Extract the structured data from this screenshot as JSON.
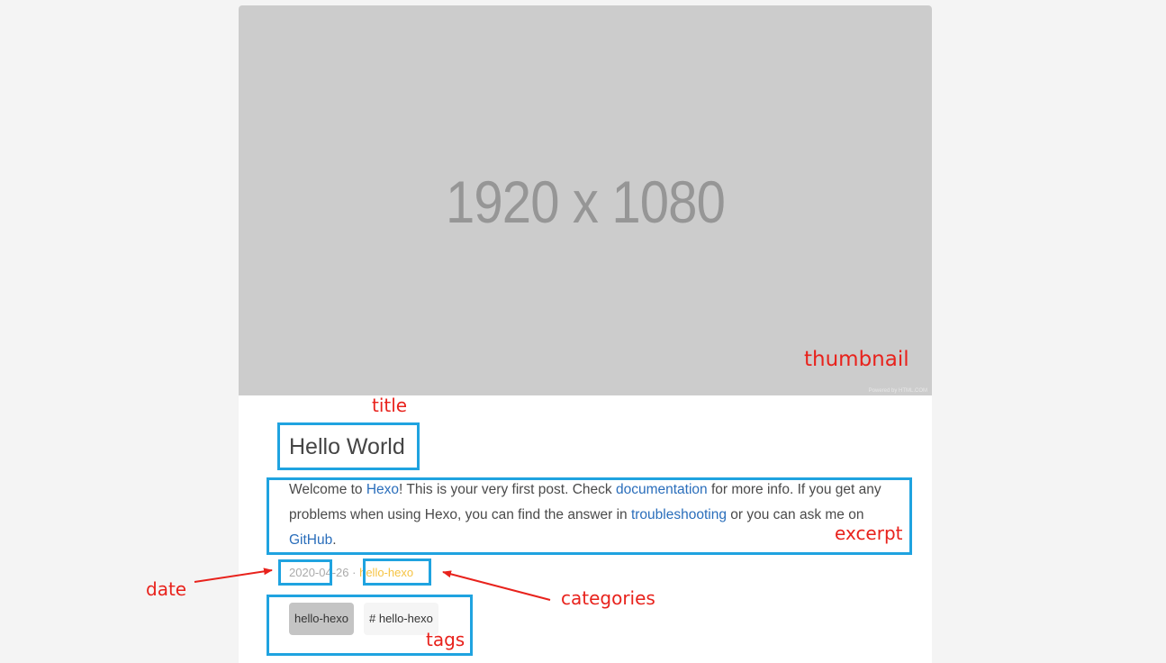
{
  "thumbnail": {
    "placeholder_text": "1920 x 1080",
    "powered_text": "Powered by HTML.COM"
  },
  "post": {
    "title": "Hello World",
    "excerpt": {
      "part1": "Welcome to ",
      "link1": "Hexo",
      "part2": "! This is your very first post. Check ",
      "link2": "documentation",
      "part3": " for more info. If you get any problems when using Hexo, you can find the answer in ",
      "link3": "troubleshooting",
      "part4": " or you can ask me on ",
      "link4": "GitHub",
      "part5": "."
    },
    "date": "2020-04-26",
    "separator": "·",
    "category": "hello-hexo",
    "tags": [
      "hello-hexo",
      "# hello-hexo"
    ]
  },
  "annotations": {
    "thumbnail": "thumbnail",
    "title": "title",
    "excerpt": "excerpt",
    "date": "date",
    "categories": "categories",
    "tags": "tags"
  },
  "colors": {
    "annotation_box": "#1fa3e0",
    "annotation_text": "#e8221c",
    "link": "#2a6ebb",
    "category": "#f6c342"
  }
}
